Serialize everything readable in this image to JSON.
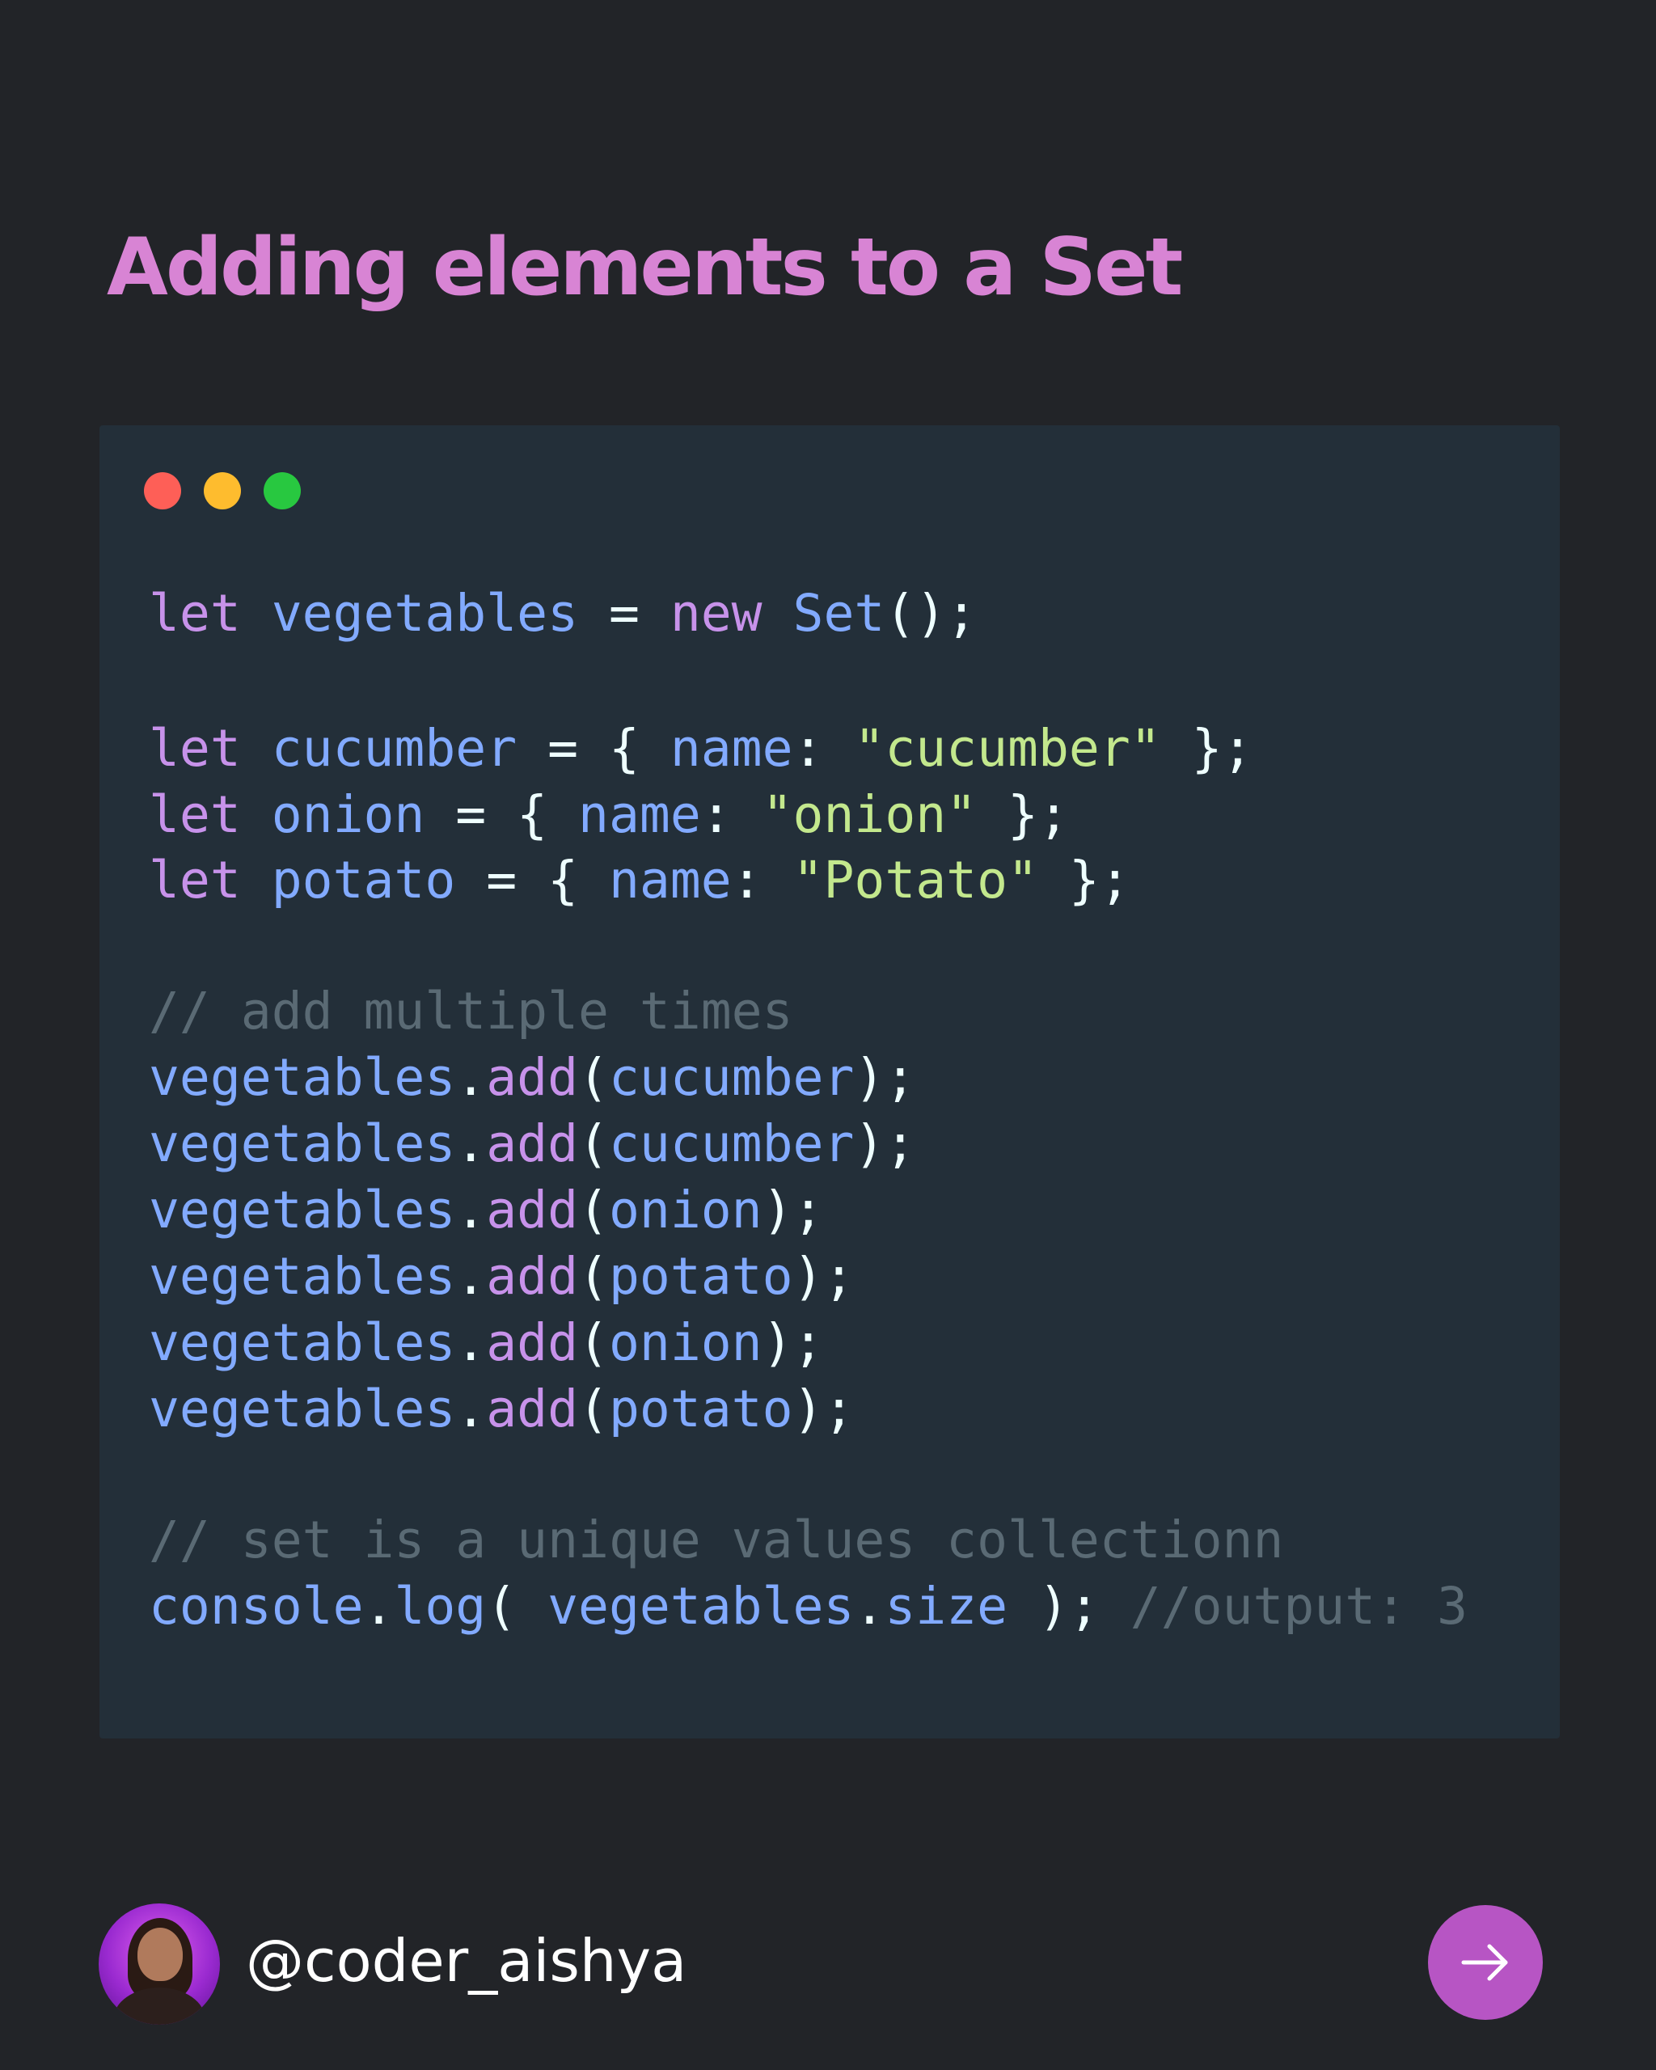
{
  "title": "Adding elements to a Set",
  "window": {
    "dots": [
      "red",
      "yellow",
      "green"
    ],
    "dot_colors": {
      "red": "#fe5f57",
      "yellow": "#febc2e",
      "green": "#28c840"
    }
  },
  "code_lines": [
    [
      [
        "kw",
        "let "
      ],
      [
        "id",
        "vegetables"
      ],
      [
        "op",
        " = "
      ],
      [
        "kw",
        "new "
      ],
      [
        "id",
        "Set"
      ],
      [
        "op",
        "();"
      ]
    ],
    [],
    [
      [
        "kw",
        "let "
      ],
      [
        "id",
        "cucumber"
      ],
      [
        "op",
        " = { "
      ],
      [
        "id",
        "name"
      ],
      [
        "op",
        ": "
      ],
      [
        "str",
        "\"cucumber\""
      ],
      [
        "op",
        " };"
      ]
    ],
    [
      [
        "kw",
        "let "
      ],
      [
        "id",
        "onion"
      ],
      [
        "op",
        " = { "
      ],
      [
        "id",
        "name"
      ],
      [
        "op",
        ": "
      ],
      [
        "str",
        "\"onion\""
      ],
      [
        "op",
        " };"
      ]
    ],
    [
      [
        "kw",
        "let "
      ],
      [
        "id",
        "potato"
      ],
      [
        "op",
        " = { "
      ],
      [
        "id",
        "name"
      ],
      [
        "op",
        ": "
      ],
      [
        "str",
        "\"Potato\""
      ],
      [
        "op",
        " };"
      ]
    ],
    [],
    [
      [
        "cm",
        "// add multiple times"
      ]
    ],
    [
      [
        "id",
        "vegetables"
      ],
      [
        "op",
        "."
      ],
      [
        "fn",
        "add"
      ],
      [
        "op",
        "("
      ],
      [
        "id",
        "cucumber"
      ],
      [
        "op",
        ");"
      ]
    ],
    [
      [
        "id",
        "vegetables"
      ],
      [
        "op",
        "."
      ],
      [
        "fn",
        "add"
      ],
      [
        "op",
        "("
      ],
      [
        "id",
        "cucumber"
      ],
      [
        "op",
        ");"
      ]
    ],
    [
      [
        "id",
        "vegetables"
      ],
      [
        "op",
        "."
      ],
      [
        "fn",
        "add"
      ],
      [
        "op",
        "("
      ],
      [
        "id",
        "onion"
      ],
      [
        "op",
        ");"
      ]
    ],
    [
      [
        "id",
        "vegetables"
      ],
      [
        "op",
        "."
      ],
      [
        "fn",
        "add"
      ],
      [
        "op",
        "("
      ],
      [
        "id",
        "potato"
      ],
      [
        "op",
        ");"
      ]
    ],
    [
      [
        "id",
        "vegetables"
      ],
      [
        "op",
        "."
      ],
      [
        "fn",
        "add"
      ],
      [
        "op",
        "("
      ],
      [
        "id",
        "onion"
      ],
      [
        "op",
        ");"
      ]
    ],
    [
      [
        "id",
        "vegetables"
      ],
      [
        "op",
        "."
      ],
      [
        "fn",
        "add"
      ],
      [
        "op",
        "("
      ],
      [
        "id",
        "potato"
      ],
      [
        "op",
        ");"
      ]
    ],
    [],
    [
      [
        "cm",
        "// set is a unique values collectionn"
      ]
    ],
    [
      [
        "id",
        "console"
      ],
      [
        "op",
        "."
      ],
      [
        "id",
        "log"
      ],
      [
        "op",
        "( "
      ],
      [
        "id",
        "vegetables"
      ],
      [
        "op",
        "."
      ],
      [
        "id",
        "size"
      ],
      [
        "op",
        " ); "
      ],
      [
        "cm",
        "//output: 3"
      ]
    ]
  ],
  "footer": {
    "handle": "@coder_aishya",
    "avatar_icon": "profile-photo",
    "next_icon": "arrow-right-icon",
    "accent": "#b755c4"
  },
  "colors": {
    "background": "#222428",
    "panel": "#232f39",
    "title": "#d884d4"
  }
}
